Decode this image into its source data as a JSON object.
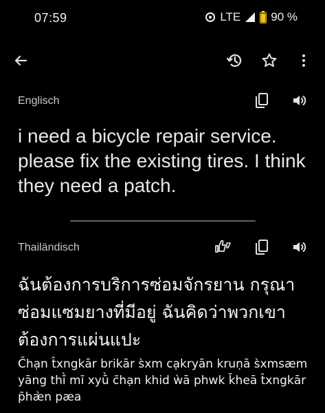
{
  "status_bar": {
    "time": "07:59",
    "network": "LTE",
    "battery": "90 %"
  },
  "app_bar": {
    "icons": [
      "back-arrow-icon",
      "history-icon",
      "star-icon",
      "more-vert-icon"
    ]
  },
  "source": {
    "language": "Englisch",
    "text": "i need a bicycle repair service. please fix the existing tires. I think they need a patch."
  },
  "target": {
    "language": "Thailändisch",
    "text": "ฉันต้องการบริการซ่อมจักรยาน กรุณาซ่อมแซมยางที่มีอยู่  ฉันคิดว่าพวกเขาต้องการแผ่นแปะ",
    "transliteration": "C̄hạn t̂xngkār brikār s̀xm cạkryān kruṇā s̀xmsæm yāng thī̀ mī xyū̀ c̄hạn khid ẁā phwk k̄heā t̂xngkār p̄hæ̀n pæa"
  },
  "colors": {
    "background": "#000000",
    "text": "#e3e3e3",
    "divider": "#5f6368"
  }
}
